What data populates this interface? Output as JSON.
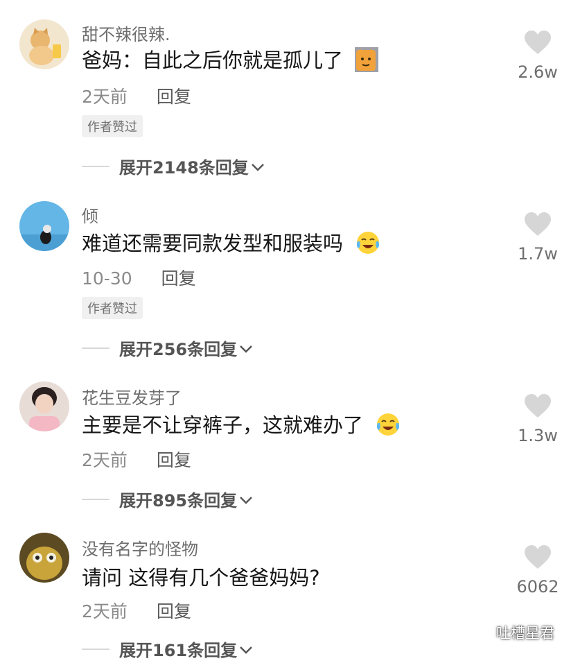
{
  "comments": [
    {
      "username": "甜不辣很辣.",
      "text": "爸妈：自此之后你就是孤儿了",
      "emoji": "cat-face-emoji",
      "time": "2天前",
      "reply_label": "回复",
      "badge": "作者赞过",
      "expand_label": "展开2148条回复",
      "likes": "2.6w"
    },
    {
      "username": "倾",
      "text": "难道还需要同款发型和服装吗",
      "emoji": "crying-laughing-emoji",
      "time": "10-30",
      "reply_label": "回复",
      "badge": "作者赞过",
      "expand_label": "展开256条回复",
      "likes": "1.7w"
    },
    {
      "username": "花生豆发芽了",
      "text": "主要是不让穿裤子，这就难办了",
      "emoji": "crying-laughing-emoji",
      "time": "2天前",
      "reply_label": "回复",
      "expand_label": "展开895条回复",
      "likes": "1.3w"
    },
    {
      "username": "没有名字的怪物",
      "text": "请问 这得有几个爸爸妈妈?",
      "time": "2天前",
      "reply_label": "回复",
      "expand_label": "展开161条回复",
      "likes": "6062"
    }
  ],
  "watermark": {
    "text": "吐槽星君",
    "icon": "wechat-official-account-icon"
  },
  "colors": {
    "like_heart": "#d6d6d6",
    "text": "#161616",
    "muted": "#8a8a8a",
    "badge_bg": "#f0f0f0"
  }
}
